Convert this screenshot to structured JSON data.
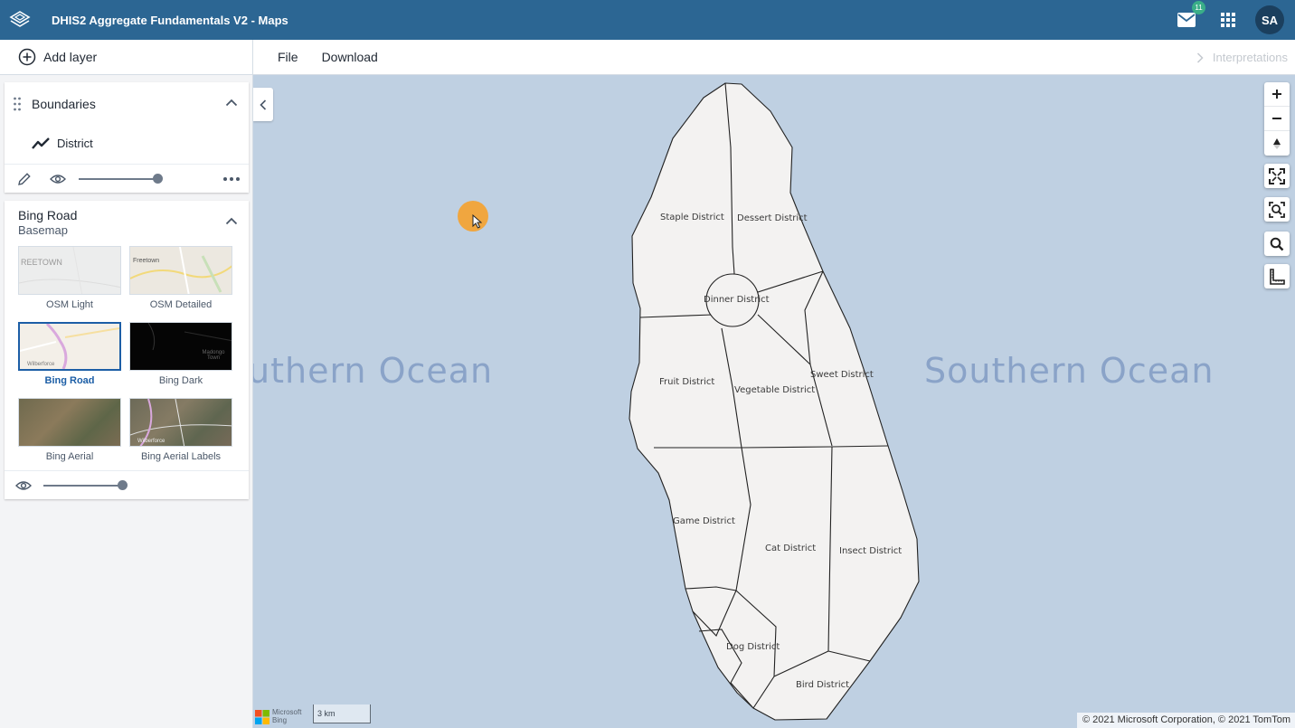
{
  "header": {
    "title": "DHIS2 Aggregate Fundamentals V2 - Maps",
    "mail_badge": "11",
    "avatar_initials": "SA",
    "icons": [
      "dhis2-logo-icon",
      "mail-icon",
      "apps-grid-icon"
    ],
    "color": "#2c6693"
  },
  "toolbar": {
    "add_layer": "Add layer",
    "file": "File",
    "download": "Download",
    "interpretations": "Interpretations"
  },
  "boundaries_layer": {
    "title": "Boundaries",
    "legend_item": "District",
    "opacity": 1.0
  },
  "basemap_layer": {
    "title": "Bing Road",
    "subtitle": "Basemap",
    "opacity": 1.0,
    "options": [
      {
        "label": "OSM Light",
        "selected": false,
        "thumb_text": "REETOWN"
      },
      {
        "label": "OSM Detailed",
        "selected": false,
        "thumb_text": "Freetown"
      },
      {
        "label": "Bing Road",
        "selected": true,
        "thumb_text": "Wilberforce"
      },
      {
        "label": "Bing Dark",
        "selected": false,
        "thumb_text": "Madongo Town"
      },
      {
        "label": "Bing Aerial",
        "selected": false,
        "thumb_text": ""
      },
      {
        "label": "Bing Aerial Labels",
        "selected": false,
        "thumb_text": "Wilberforce"
      }
    ]
  },
  "map": {
    "ocean_left": "uthern Ocean",
    "ocean_right": "Southern Ocean",
    "districts": [
      "Staple District",
      "Dessert District",
      "Dinner District",
      "Fruit District",
      "Vegetable District",
      "Sweet District",
      "Game District",
      "Cat District",
      "Insect District",
      "Dog District",
      "Bird District"
    ],
    "scale": "3 km",
    "bing_brand": [
      "Microsoft",
      "Bing"
    ],
    "attribution": "© 2021 Microsoft Corporation, © 2021 TomTom",
    "ocean_color": "#bfd0e2",
    "district_fill": "#f3f2f1"
  }
}
